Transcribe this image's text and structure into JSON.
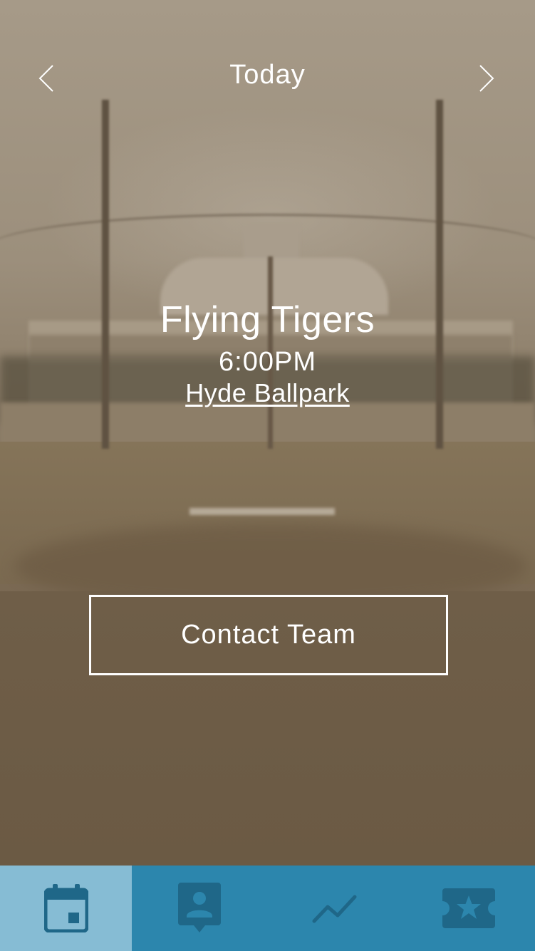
{
  "header": {
    "title": "Today",
    "prev_icon": "chevron-left-icon",
    "next_icon": "chevron-right-icon"
  },
  "event": {
    "team": "Flying Tigers",
    "time": "6:00PM",
    "venue": "Hyde Ballpark"
  },
  "actions": {
    "contact_label": "Contact Team"
  },
  "tabbar": {
    "active_index": 0,
    "tabs": [
      {
        "icon": "calendar-icon"
      },
      {
        "icon": "profile-badge-icon"
      },
      {
        "icon": "trend-line-icon"
      },
      {
        "icon": "ticket-star-icon"
      }
    ]
  },
  "colors": {
    "tab_bar": "#2c86ad",
    "tab_active": "#86bcd4",
    "tab_icon": "#1f6788",
    "text": "#ffffff"
  }
}
